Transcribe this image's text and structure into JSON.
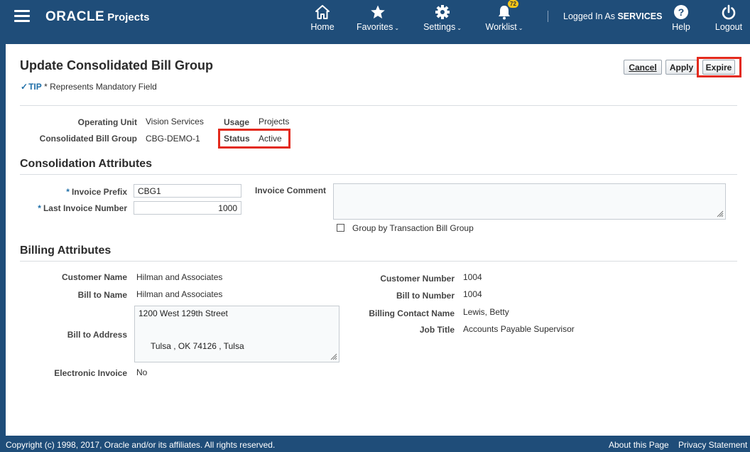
{
  "header": {
    "brand": "ORACLE",
    "product": "Projects",
    "nav": [
      {
        "label": "Home",
        "icon": "home-icon"
      },
      {
        "label": "Favorites",
        "icon": "star-icon"
      },
      {
        "label": "Settings",
        "icon": "gear-icon"
      },
      {
        "label": "Worklist",
        "icon": "bell-icon",
        "badge": "72"
      }
    ],
    "logged_prefix": "Logged In As",
    "user": "SERVICES",
    "help": "Help",
    "logout": "Logout"
  },
  "page": {
    "title": "Update Consolidated Bill Group",
    "tip_word": "TIP",
    "tip_text": "* Represents Mandatory Field",
    "buttons": {
      "cancel": "Cancel",
      "apply": "Apply",
      "expire": "Expire"
    }
  },
  "summary": {
    "operating_unit_label": "Operating Unit",
    "operating_unit": "Vision Services",
    "cbg_label": "Consolidated Bill Group",
    "cbg": "CBG-DEMO-1",
    "usage_label": "Usage",
    "usage": "Projects",
    "status_label": "Status",
    "status": "Active"
  },
  "consolidation": {
    "heading": "Consolidation Attributes",
    "invoice_prefix_label": "Invoice Prefix",
    "invoice_prefix": "CBG1",
    "last_invoice_label": "Last Invoice Number",
    "last_invoice": "1000",
    "invoice_comment_label": "Invoice Comment",
    "invoice_comment": "",
    "group_by_label": "Group by Transaction Bill Group",
    "group_by_checked": false
  },
  "billing": {
    "heading": "Billing Attributes",
    "customer_name_label": "Customer Name",
    "customer_name": "Hilman and Associates",
    "bill_to_name_label": "Bill to Name",
    "bill_to_name": "Hilman and Associates",
    "bill_to_address_label": "Bill to Address",
    "address_line1": "1200 West 129th Street",
    "address_line2": "Tulsa , OK 74126 , Tulsa",
    "electronic_invoice_label": "Electronic Invoice",
    "electronic_invoice": "No",
    "customer_number_label": "Customer Number",
    "customer_number": "1004",
    "bill_to_number_label": "Bill to Number",
    "bill_to_number": "1004",
    "billing_contact_label": "Billing Contact Name",
    "billing_contact": "Lewis, Betty",
    "job_title_label": "Job Title",
    "job_title": "Accounts Payable Supervisor"
  },
  "footer": {
    "copyright": "Copyright (c) 1998, 2017, Oracle and/or its affiliates. All rights reserved.",
    "about": "About this Page",
    "privacy": "Privacy Statement"
  },
  "colors": {
    "header_bg": "#1f4d79",
    "highlight": "#e32a1c",
    "accent": "#1f6fa8"
  }
}
